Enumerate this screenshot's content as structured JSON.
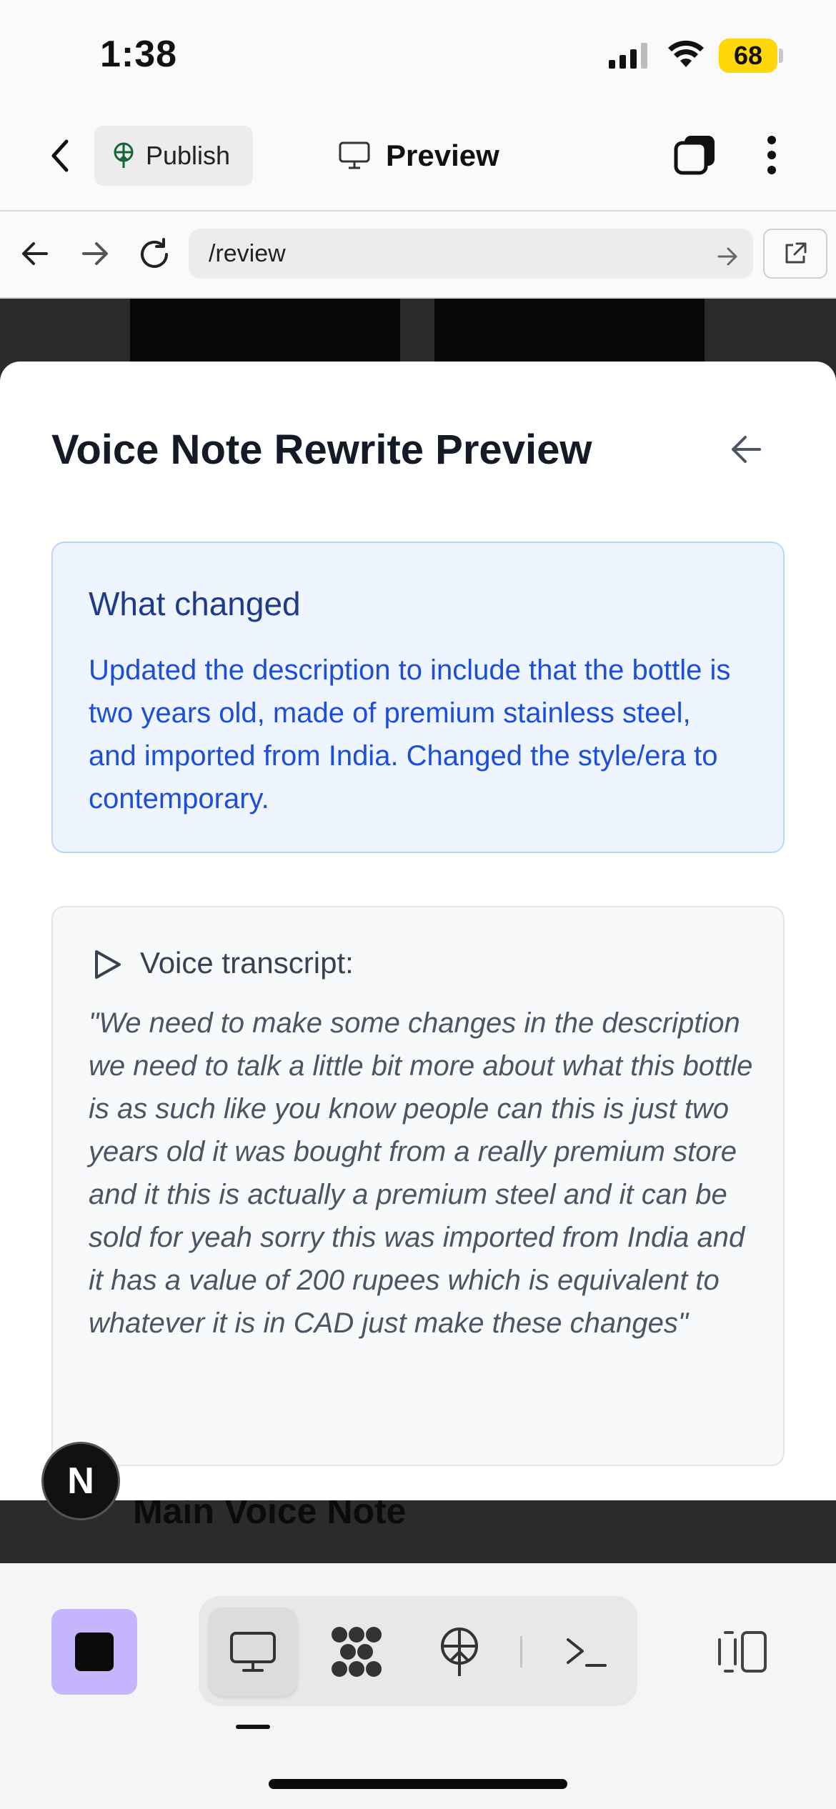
{
  "status_bar": {
    "time": "1:38",
    "battery": "68"
  },
  "header": {
    "publish_label": "Publish",
    "title": "Preview"
  },
  "browser": {
    "url": "/review"
  },
  "sheet": {
    "title": "Voice Note Rewrite Preview",
    "changes": {
      "heading": "What changed",
      "body": "Updated the description to include that the bottle is two years old, made of premium stainless steel, and imported from India. Changed the style/era to contemporary."
    },
    "transcript": {
      "heading": "Voice transcript:",
      "body": "\"We need to make some changes in the description we need to talk a little bit more about what this bottle is as such like you know people can this is just two years old it was bought from a really premium store and it this is actually a premium steel and it can be sold for yeah sorry this was imported from India and it has a value of 200 rupees which is equivalent to whatever it is in CAD just make these changes\""
    }
  },
  "background_page": {
    "section_title": "Main Voice Note"
  },
  "badge": {
    "letter": "N"
  },
  "toolbar": {
    "items": [
      "monitor-icon",
      "apps-icon",
      "publish-icon",
      "terminal-icon"
    ],
    "accent": "#c4b5fd"
  }
}
